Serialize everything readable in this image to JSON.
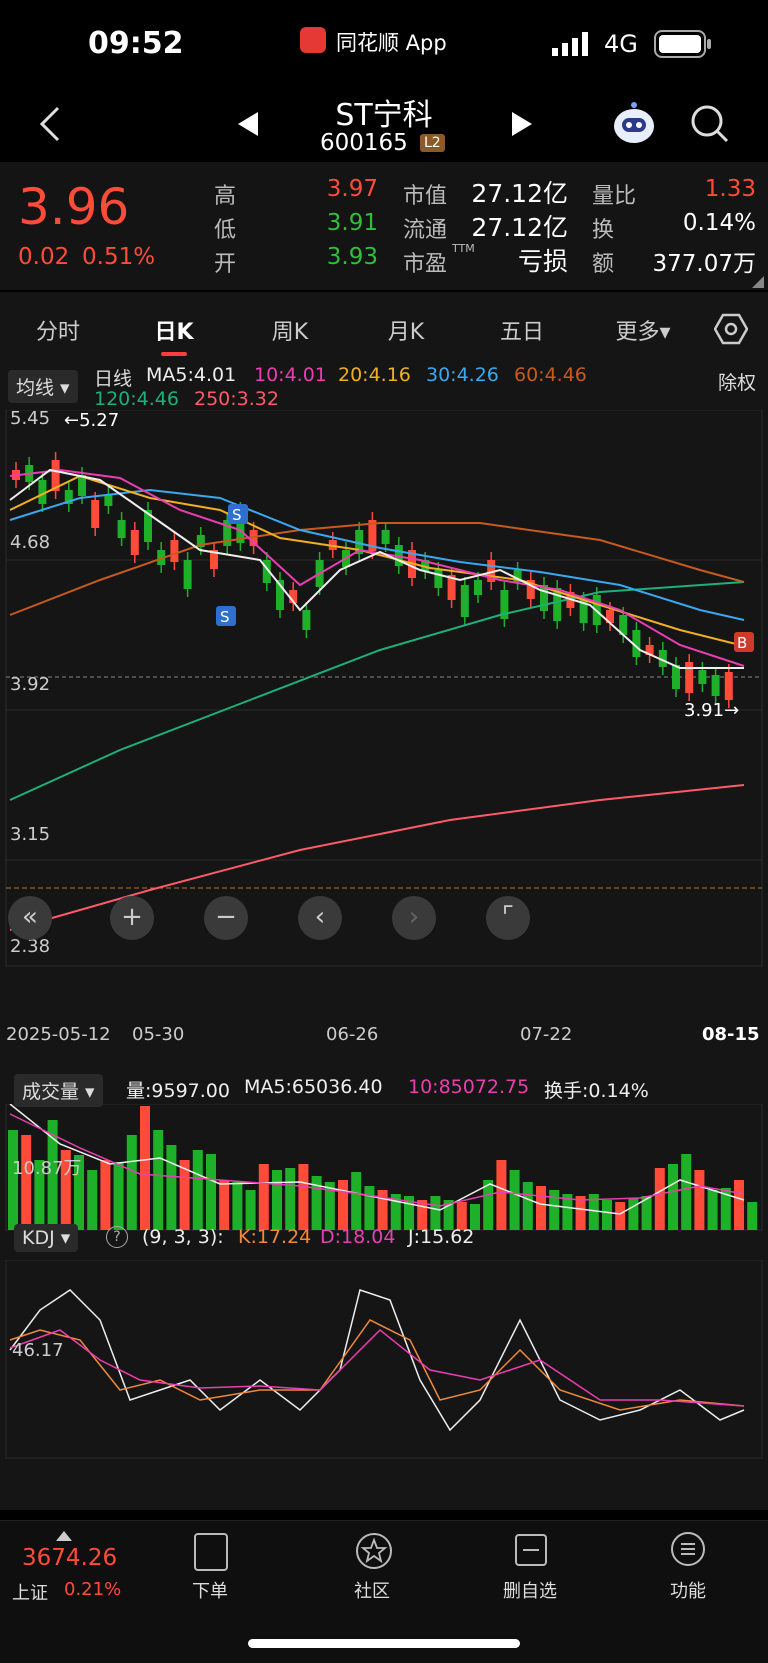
{
  "status": {
    "time": "09:52",
    "app": "同花顺 App",
    "network": "4G"
  },
  "nav": {
    "name": "ST宁科",
    "code": "600165",
    "level": "L2"
  },
  "quote": {
    "price": "3.96",
    "change": "0.02",
    "change_pct": "0.51%",
    "high_label": "高",
    "high": "3.97",
    "low_label": "低",
    "low": "3.91",
    "open_label": "开",
    "open": "3.93",
    "mcap_label": "市值",
    "mcap": "27.12亿",
    "float_label": "流通",
    "float": "27.12亿",
    "pe_label": "市盈",
    "pe_sup": "TTM",
    "pe": "亏损",
    "vr_label": "量比",
    "vr": "1.33",
    "turn_label": "换",
    "turn": "0.14%",
    "amt_label": "额",
    "amt": "377.07万"
  },
  "tabs": [
    "分时",
    "日K",
    "周K",
    "月K",
    "五日",
    "更多▾"
  ],
  "kline": {
    "selector": "均线",
    "period": "日线",
    "ma5": "MA5:4.01",
    "ma10": "10:4.01",
    "ma20": "20:4.16",
    "ma30": "30:4.26",
    "ma60": "60:4.46",
    "ma120": "120:4.46",
    "ma250": "250:3.32",
    "exright": "除权",
    "y_labels": [
      "5.45",
      "4.68",
      "3.92",
      "3.15",
      "2.38"
    ],
    "high_mark": "←5.27",
    "low_mark": "3.91→",
    "x_labels": [
      "2025-05-12",
      "05-30",
      "06-26",
      "07-22",
      "08-15"
    ],
    "signal_s": "S",
    "signal_b": "B"
  },
  "volume": {
    "selector": "成交量",
    "vol": "量:9597.00",
    "ma5": "MA5:65036.40",
    "ma10": "10:85072.75",
    "turnover": "换手:0.14%",
    "y_label": "10.87万"
  },
  "kdj": {
    "selector": "KDJ",
    "help": "?",
    "params": "(9, 3, 3):",
    "k": "K:17.24",
    "d": "D:18.04",
    "j": "J:15.62",
    "y_label": "46.17"
  },
  "bottom": {
    "index_value": "3674.26",
    "index_name": "上证",
    "index_pct": "0.21%",
    "order": "下单",
    "community": "社区",
    "watch": "删自选",
    "func": "功能"
  },
  "chart_data": {
    "type": "candlestick",
    "x": [
      "2025-05-12",
      "05-30",
      "06-26",
      "07-22",
      "08-15"
    ],
    "y_range": [
      2.38,
      5.45
    ],
    "last_close": 3.96,
    "ma": {
      "MA5": 4.01,
      "MA10": 4.01,
      "MA20": 4.16,
      "MA30": 4.26,
      "MA60": 4.46,
      "MA120": 4.46,
      "MA250": 3.32
    },
    "high": 5.27,
    "low": 3.91
  }
}
